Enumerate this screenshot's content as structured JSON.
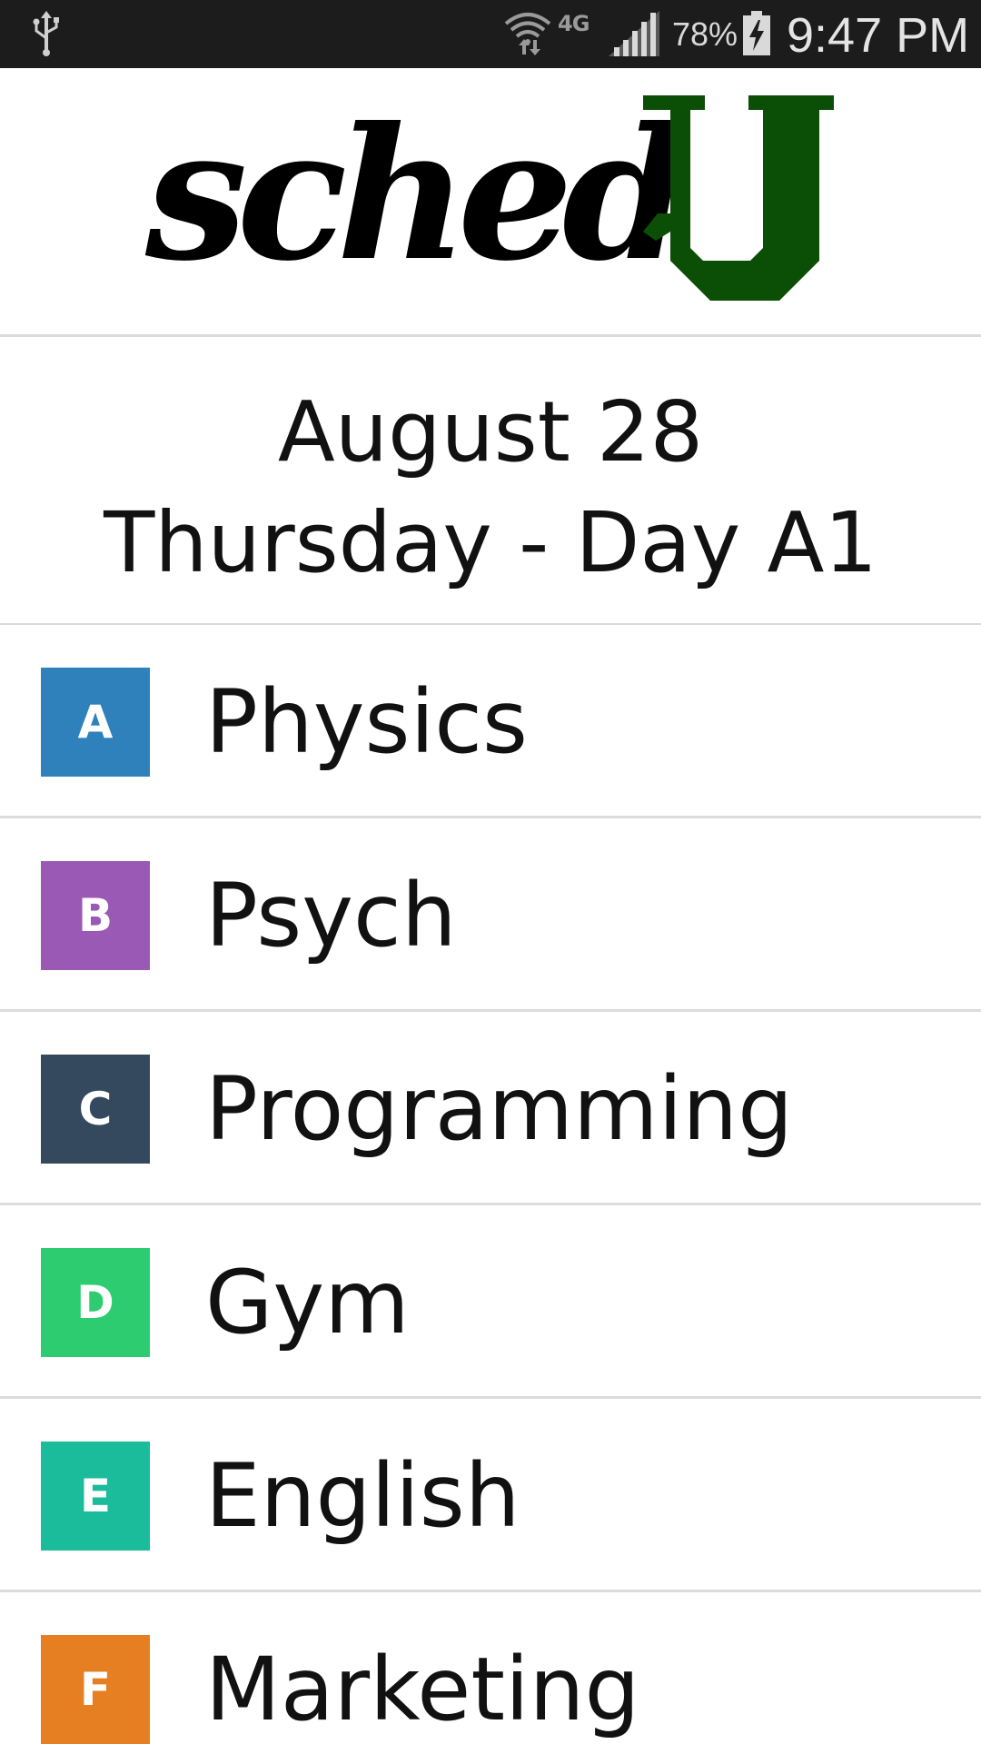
{
  "status_bar": {
    "icons": [
      "usb-icon",
      "wifi-icon",
      "lte-icon",
      "signal-icon",
      "battery-charging-icon"
    ],
    "network": "4G",
    "battery": "78%",
    "time": "9:47 PM"
  },
  "header": {
    "logo_script": "sched",
    "logo_letter": "U",
    "colors": {
      "script": "#000000",
      "letter": "#0b4f06"
    }
  },
  "date": {
    "line1": "August 28",
    "line2": "Thursday - Day A1"
  },
  "classes": [
    {
      "period": "A",
      "name": "Physics",
      "color": "#2e81bb"
    },
    {
      "period": "B",
      "name": "Psych",
      "color": "#9b59b6"
    },
    {
      "period": "C",
      "name": "Programming",
      "color": "#34495e"
    },
    {
      "period": "D",
      "name": "Gym",
      "color": "#2ecc71"
    },
    {
      "period": "E",
      "name": "English",
      "color": "#1abc9c"
    },
    {
      "period": "F",
      "name": "Marketing",
      "color": "#e67e22"
    }
  ]
}
